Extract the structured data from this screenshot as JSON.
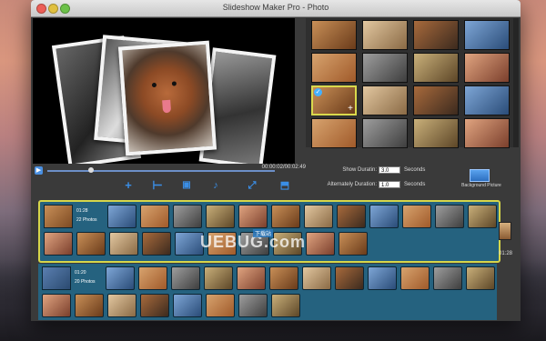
{
  "window": {
    "title": "Slideshow Maker Pro - Photo"
  },
  "player": {
    "elapsed_total": "00:00:02/00:02:49",
    "progress": 0.19
  },
  "toolbar": {
    "icons": [
      "add-icon",
      "trim-icon",
      "photo-edit-icon",
      "music-icon",
      "fullscreen-icon",
      "export-icon"
    ]
  },
  "settings": {
    "show_duration_label": "Show Duratin:",
    "show_duration_value": "3.0",
    "show_duration_unit": "Seconds",
    "alt_duration_label": "Alternately Duration:",
    "alt_duration_value": "1.0",
    "alt_duration_unit": "Seconds",
    "bg_picture_label": "Background Picture"
  },
  "timeline": {
    "group1": {
      "duration": "01:28",
      "count": "22 Photos"
    },
    "group2": {
      "duration": "01:20",
      "count": "20 Photos"
    },
    "side_time": "01:28"
  },
  "watermark": {
    "text": "UEBUG.com",
    "badge": "下载站"
  },
  "colors": {
    "accent": "#3a8ee6",
    "timeline_bg": "#25627f",
    "selection": "#d6d64a"
  }
}
